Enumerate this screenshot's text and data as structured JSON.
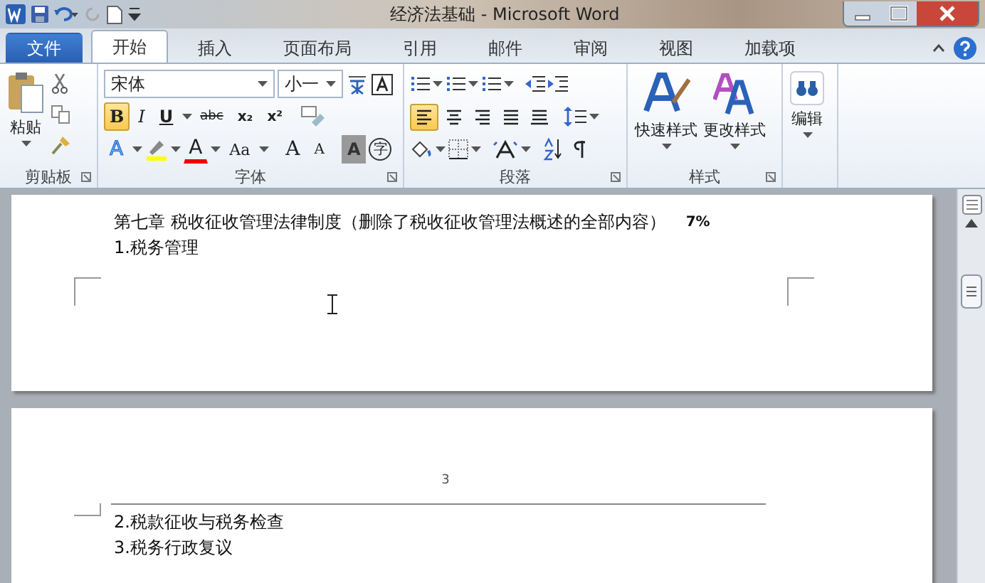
{
  "window": {
    "title": "经济法基础 - Microsoft Word"
  },
  "tabs": [
    {
      "label": "文件",
      "kind": "file",
      "selected": false
    },
    {
      "label": "开始",
      "kind": "tab",
      "selected": true
    },
    {
      "label": "插入",
      "kind": "tab",
      "selected": false
    },
    {
      "label": "页面布局",
      "kind": "tab",
      "selected": false
    },
    {
      "label": "引用",
      "kind": "tab",
      "selected": false
    },
    {
      "label": "邮件",
      "kind": "tab",
      "selected": false
    },
    {
      "label": "审阅",
      "kind": "tab",
      "selected": false
    },
    {
      "label": "视图",
      "kind": "tab",
      "selected": false
    },
    {
      "label": "加载项",
      "kind": "tab",
      "selected": false
    }
  ],
  "ribbon": {
    "clipboard": {
      "paste": "粘贴",
      "label": "剪贴板"
    },
    "font": {
      "font_name": "宋体",
      "font_size": "小一",
      "label": "字体",
      "format_buttons": [
        {
          "kind": "bold",
          "label": "B",
          "selected": true
        },
        {
          "kind": "italic",
          "label": "I",
          "selected": false
        },
        {
          "kind": "underline",
          "label": "U",
          "selected": false
        },
        {
          "kind": "strike",
          "label": "abc",
          "selected": false
        },
        {
          "kind": "sub",
          "label": "x₂",
          "selected": false
        },
        {
          "kind": "sup",
          "label": "x²",
          "selected": false
        }
      ],
      "effect_buttons": [
        {
          "kind": "effect",
          "label": "A"
        },
        {
          "kind": "highlight"
        },
        {
          "kind": "color",
          "label": "A"
        },
        {
          "kind": "case",
          "label": "Aa"
        },
        {
          "kind": "grow",
          "label": "A"
        },
        {
          "kind": "shrink",
          "label": "A"
        },
        {
          "kind": "shade",
          "label": "A"
        },
        {
          "kind": "enclose",
          "label": "字"
        }
      ]
    },
    "paragraph": {
      "label": "段落",
      "alignment": [
        {
          "kind": "left",
          "selected": true
        },
        {
          "kind": "center",
          "selected": false
        },
        {
          "kind": "right",
          "selected": false
        },
        {
          "kind": "justify",
          "selected": false
        },
        {
          "kind": "distributed",
          "selected": false
        }
      ]
    },
    "styles": {
      "quick": "快速样式",
      "change": "更改样式",
      "label": "样式"
    },
    "editing": {
      "label": "编辑"
    }
  },
  "document": {
    "pages": [
      {
        "lines": [
          {
            "text": "第七章  税收征收管理法律制度（删除了税收征收管理法概述的全部内容）",
            "note": "7%"
          },
          {
            "text": "1.税务管理"
          }
        ]
      },
      {
        "page_number": "3",
        "lines": [
          {
            "text": "2.税款征收与税务检查"
          },
          {
            "text": "3.税务行政复议"
          }
        ]
      }
    ]
  }
}
